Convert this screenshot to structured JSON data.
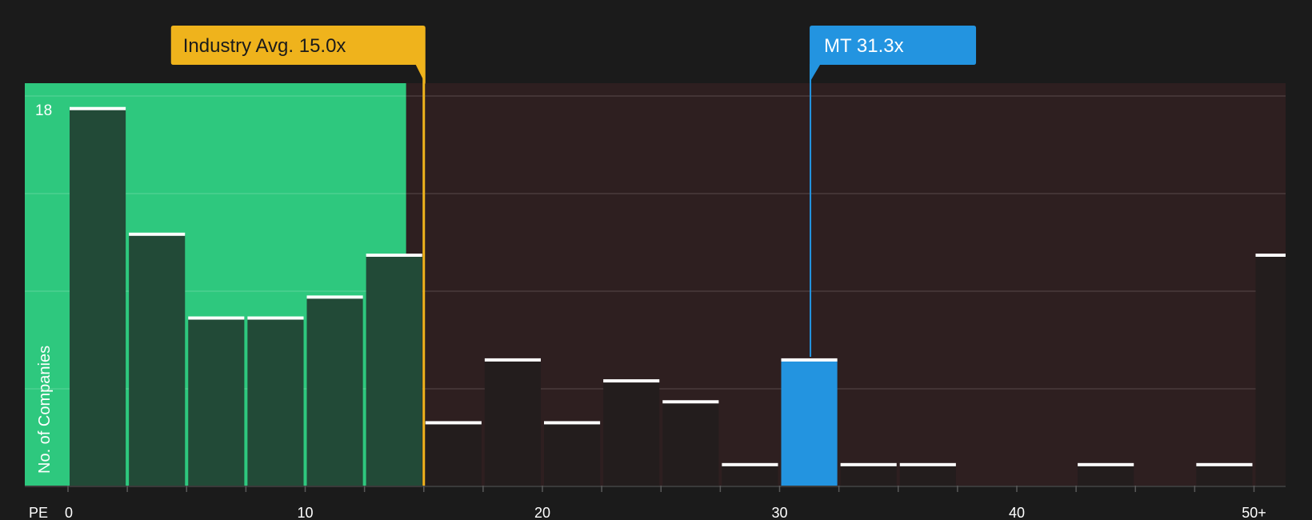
{
  "chart_data": {
    "type": "bar",
    "title": "",
    "xlabel": "PE",
    "ylabel": "No. of Companies",
    "xlim": [
      0,
      51.3
    ],
    "ylim": [
      0,
      18.6
    ],
    "y_max_label": "18",
    "x_ticks": [
      0,
      10,
      20,
      30,
      40,
      50
    ],
    "x_tick_labels": [
      "0",
      "10",
      "20",
      "30",
      "40",
      "50+"
    ],
    "bin_width": 2.5,
    "bins": [
      {
        "start": 0.0,
        "value": 18
      },
      {
        "start": 2.5,
        "value": 12
      },
      {
        "start": 5.0,
        "value": 8
      },
      {
        "start": 7.5,
        "value": 8
      },
      {
        "start": 10.0,
        "value": 9
      },
      {
        "start": 12.5,
        "value": 11
      },
      {
        "start": 15.0,
        "value": 3
      },
      {
        "start": 17.5,
        "value": 6
      },
      {
        "start": 20.0,
        "value": 3
      },
      {
        "start": 22.5,
        "value": 5
      },
      {
        "start": 25.0,
        "value": 4
      },
      {
        "start": 27.5,
        "value": 1
      },
      {
        "start": 30.0,
        "value": 6,
        "highlight": true
      },
      {
        "start": 32.5,
        "value": 1
      },
      {
        "start": 35.0,
        "value": 1
      },
      {
        "start": 37.5,
        "value": 0
      },
      {
        "start": 40.0,
        "value": 0
      },
      {
        "start": 42.5,
        "value": 1
      },
      {
        "start": 45.0,
        "value": 0
      },
      {
        "start": 47.5,
        "value": 1
      },
      {
        "start": 50.0,
        "value": 11
      }
    ],
    "industry_avg": {
      "value": 15.0,
      "label": "Industry Avg. 15.0x"
    },
    "company": {
      "value": 31.3,
      "label": "MT 31.3x"
    },
    "colors": {
      "background": "#1b1b1b",
      "below_avg_region": "#2ec87e",
      "above_avg_region": "#2e1f20",
      "bar_in_green": "#224a37",
      "bar_in_red": "#231d1d",
      "bar_cap": "#ffffff",
      "highlight_bar": "#2394e0",
      "industry_callout": "#efb31c",
      "company_callout": "#2394e0",
      "gridline": "#4a3c3c"
    }
  }
}
